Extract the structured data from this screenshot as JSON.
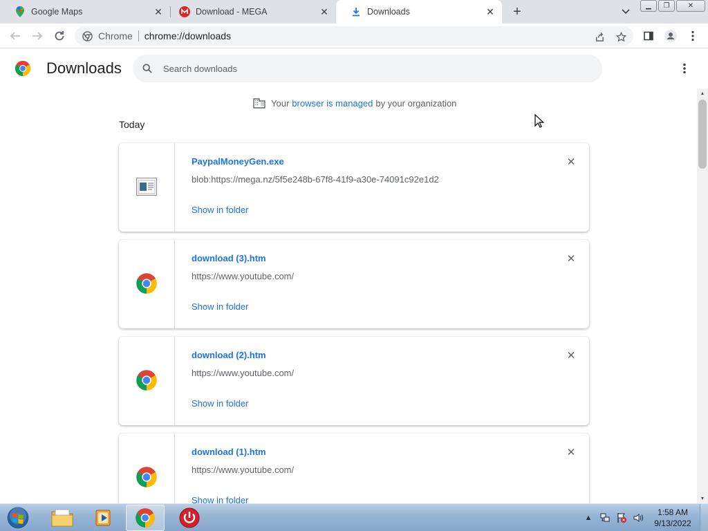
{
  "tabs": [
    {
      "title": "Google Maps",
      "icon": "google-maps-icon"
    },
    {
      "title": "Download - MEGA",
      "icon": "mega-icon"
    },
    {
      "title": "Downloads",
      "icon": "download-icon",
      "active": true
    }
  ],
  "toolbar": {
    "site_label": "Chrome",
    "url": "chrome://downloads"
  },
  "downloads_page": {
    "title": "Downloads",
    "search_placeholder": "Search downloads",
    "managed": {
      "prefix": "Your",
      "link": "browser is managed",
      "suffix": "by your organization"
    },
    "section_date": "Today",
    "items": [
      {
        "name": "PaypalMoneyGen.exe",
        "url": "blob:https://mega.nz/5f5e248b-67f8-41f9-a30e-74091c92e1d2",
        "action": "Show in folder",
        "icon": "exe-file-icon"
      },
      {
        "name": "download (3).htm",
        "url": "https://www.youtube.com/",
        "action": "Show in folder",
        "icon": "chrome-icon"
      },
      {
        "name": "download (2).htm",
        "url": "https://www.youtube.com/",
        "action": "Show in folder",
        "icon": "chrome-icon"
      },
      {
        "name": "download (1).htm",
        "url": "https://www.youtube.com/",
        "action": "Show in folder",
        "icon": "chrome-icon"
      }
    ]
  },
  "taskbar": {
    "apps": [
      "windows-explorer",
      "media-player",
      "chrome",
      "power-app"
    ],
    "clock": {
      "time": "1:58 AM",
      "date": "9/13/2022"
    }
  },
  "colors": {
    "link_blue": "#1a73e8",
    "tab_strip": "#dee1e6",
    "secondary_text": "#5f6368"
  }
}
